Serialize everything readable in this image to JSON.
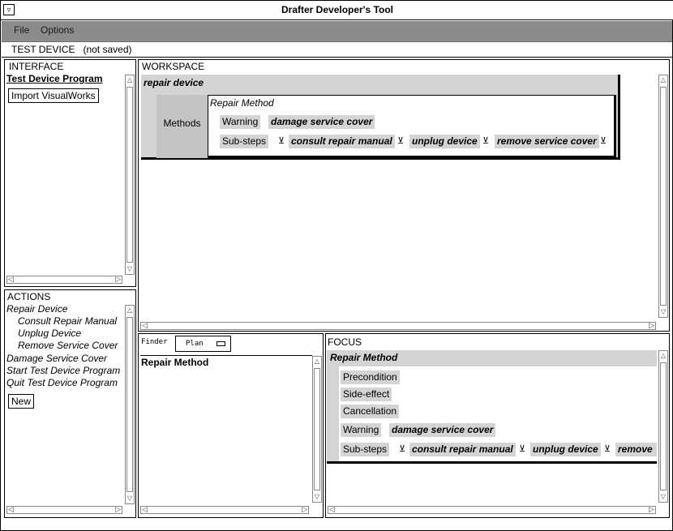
{
  "window": {
    "title": "Drafter Developer's Tool",
    "menu_icon": "minimize-icon"
  },
  "menubar": {
    "file": "File",
    "options": "Options"
  },
  "status": {
    "text": "TEST DEVICE   (not saved)"
  },
  "interface": {
    "label": "INTERFACE",
    "program": "Test Device Program",
    "import_button": "Import VisualWorks"
  },
  "actions": {
    "label": "ACTIONS",
    "items": [
      "Repair Device",
      "Consult Repair Manual",
      "Unplug Device",
      "Remove Service Cover",
      "Damage Service Cover",
      "Start Test Device Program",
      "Quit Test Device Program"
    ],
    "new_button": "New"
  },
  "workspace": {
    "label": "WORKSPACE",
    "node_title": "repair device",
    "methods_label": "Methods",
    "method_title": "Repair Method",
    "warning_label": "Warning",
    "warning_value": "damage service cover",
    "substeps_label": "Sub-steps",
    "substeps": [
      "consult repair manual",
      "unplug device",
      "remove service cover"
    ],
    "step_arrow": "⊻"
  },
  "finder": {
    "label": "Finder",
    "select_value": "Plan",
    "results": [
      "Repair Method"
    ]
  },
  "focus": {
    "label": "FOCUS",
    "title": "Repair Method",
    "precondition": "Precondition",
    "side_effect": "Side-effect",
    "cancellation": "Cancellation",
    "warning_label": "Warning",
    "warning_value": "damage service cover",
    "substeps_label": "Sub-steps",
    "substeps": [
      "consult repair manual",
      "unplug device",
      "remove"
    ]
  }
}
